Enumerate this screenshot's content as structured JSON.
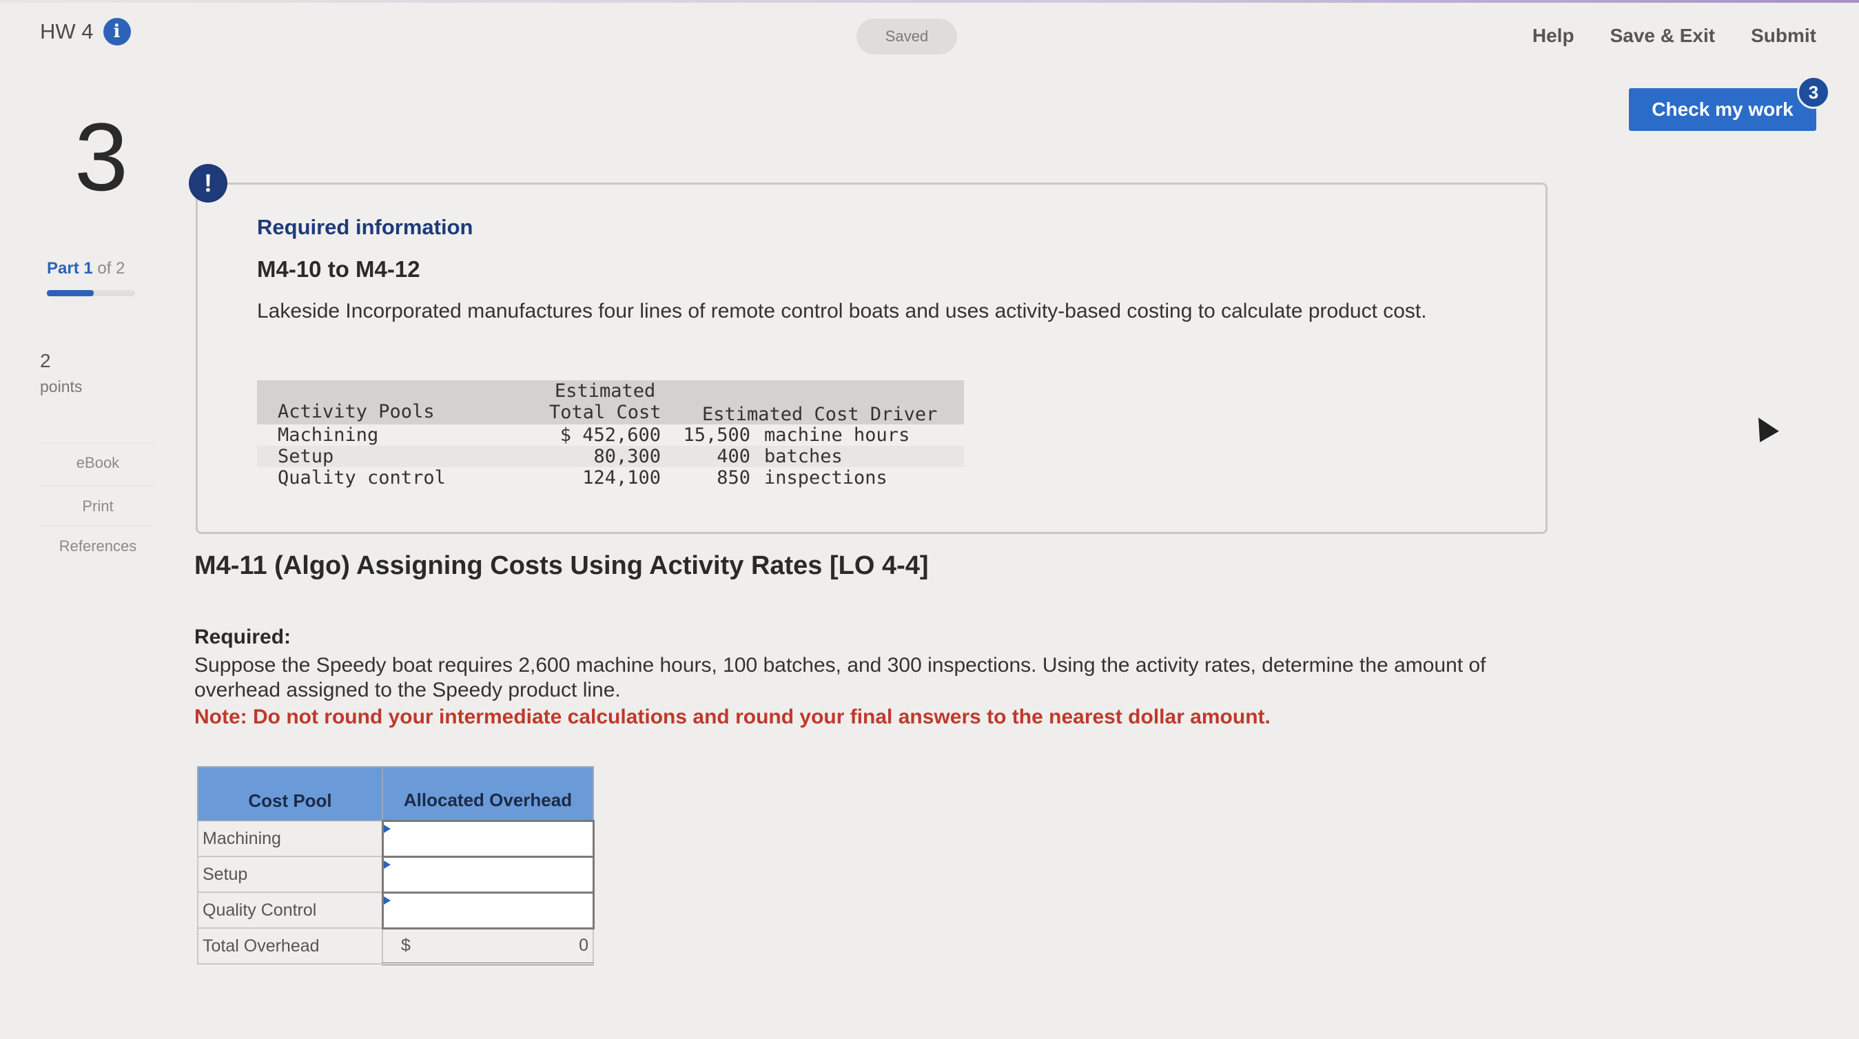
{
  "header": {
    "assignment_title": "HW 4",
    "saved_status": "Saved",
    "nav": {
      "help": "Help",
      "save_exit": "Save & Exit",
      "submit": "Submit"
    },
    "check_my_work": "Check my work",
    "check_badge_count": "3"
  },
  "sidebar": {
    "question_number": "3",
    "part_prefix": "Part",
    "part_current": "1",
    "part_of": "of 2",
    "part_progress": 0.5,
    "points_value": "2",
    "points_label": "points",
    "links": {
      "ebook": "eBook",
      "print": "Print",
      "references": "References"
    }
  },
  "info_box": {
    "heading": "Required information",
    "range": "M4-10 to M4-12",
    "intro": "Lakeside Incorporated manufactures four lines of remote control boats and uses activity-based costing to calculate product cost.",
    "table": {
      "header_col1": "Activity Pools",
      "header_col2_line1": "Estimated",
      "header_col2_line2": "Total Cost",
      "header_col3": "Estimated Cost Driver",
      "rows": [
        {
          "pool": "Machining",
          "cost": "$ 452,600",
          "driver_qty": "15,500",
          "driver_unit": "machine hours"
        },
        {
          "pool": "Setup",
          "cost": "80,300",
          "driver_qty": "400",
          "driver_unit": "batches"
        },
        {
          "pool": "Quality control",
          "cost": "124,100",
          "driver_qty": "850",
          "driver_unit": "inspections"
        }
      ]
    }
  },
  "question": {
    "title": "M4-11 (Algo) Assigning Costs Using Activity Rates [LO 4-4]",
    "required_label": "Required:",
    "text": "Suppose the Speedy boat requires 2,600 machine hours, 100 batches, and 300 inspections. Using the activity rates, determine the amount of overhead assigned to the Speedy product line.",
    "note": "Note: Do not round your intermediate calculations and round your final answers to the nearest dollar amount."
  },
  "answer_table": {
    "col1": "Cost Pool",
    "col2": "Allocated Overhead",
    "rows": [
      {
        "label": "Machining",
        "value": ""
      },
      {
        "label": "Setup",
        "value": ""
      },
      {
        "label": "Quality Control",
        "value": ""
      }
    ],
    "total_label": "Total Overhead",
    "total_currency": "$",
    "total_value": "0"
  },
  "colors": {
    "accent_blue": "#2c63b8",
    "note_red": "#c0392b",
    "table_header_blue": "#6b9ad8"
  }
}
